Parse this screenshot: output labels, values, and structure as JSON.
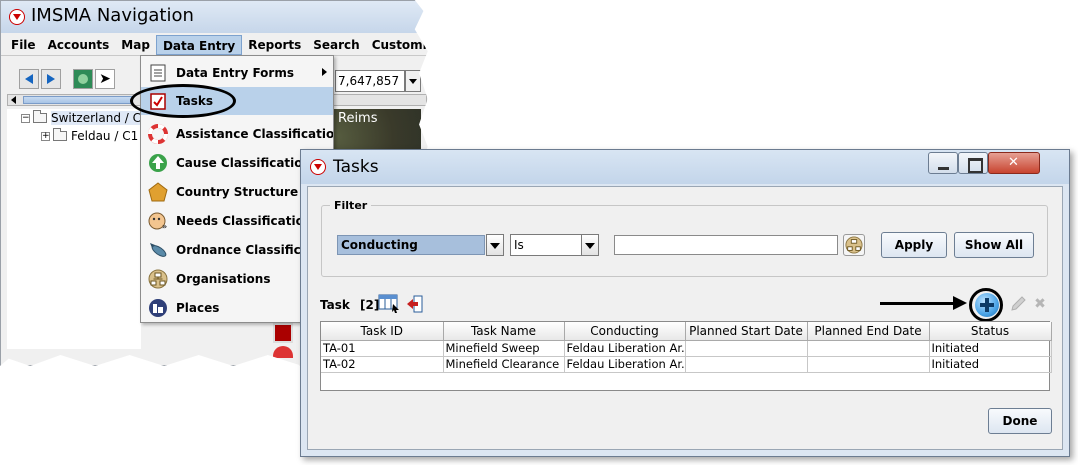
{
  "nav_window": {
    "title": "IMSMA Navigation",
    "menus": [
      "File",
      "Accounts",
      "Map",
      "Data Entry",
      "Reports",
      "Search",
      "Customisation"
    ],
    "coordinate_value": "7,647,857",
    "tree": [
      {
        "label": "Switzerland / C",
        "toggle": "−"
      },
      {
        "label": "Feldau / C1",
        "toggle": "+"
      }
    ],
    "map_label": "Reims"
  },
  "data_entry_menu": {
    "items": [
      {
        "label": "Data Entry Forms",
        "icon": "form-icon",
        "has_submenu": true
      },
      {
        "label": "Tasks",
        "icon": "tasks-clipboard-icon",
        "highlighted": true
      },
      {
        "label": "Assistance Classification",
        "icon": "lifebuoy-icon"
      },
      {
        "label": "Cause Classification",
        "icon": "up-arrow-icon"
      },
      {
        "label": "Country Structure",
        "icon": "pentagon-icon"
      },
      {
        "label": "Needs Classification",
        "icon": "face-icon"
      },
      {
        "label": "Ordnance Classification",
        "icon": "ordnance-icon"
      },
      {
        "label": "Organisations",
        "icon": "organisation-chart-icon"
      },
      {
        "label": "Places",
        "icon": "places-icon"
      }
    ]
  },
  "tasks_dialog": {
    "title": "Tasks",
    "filter": {
      "legend": "Filter",
      "field_value": "Conducting",
      "operator_value": "Is",
      "text_value": "",
      "apply_label": "Apply",
      "show_all_label": "Show All"
    },
    "task_label": "Task",
    "task_count": "[2]",
    "table": {
      "columns": [
        "Task ID",
        "Task Name",
        "Conducting",
        "Planned Start Date",
        "Planned End Date",
        "Status"
      ],
      "rows": [
        [
          "TA-01",
          "Minefield Sweep",
          "Feldau Liberation Ar...",
          "",
          "",
          "Initiated"
        ],
        [
          "TA-02",
          "Minefield Clearance",
          "Feldau Liberation Ar...",
          "",
          "",
          "Initiated"
        ]
      ]
    },
    "done_label": "Done"
  },
  "colors": {
    "menu_highlight": "#b9d1ea",
    "dialog_frame": "#dce6f2",
    "close_button": "#c8442f",
    "add_button": "#4aa3e6"
  }
}
